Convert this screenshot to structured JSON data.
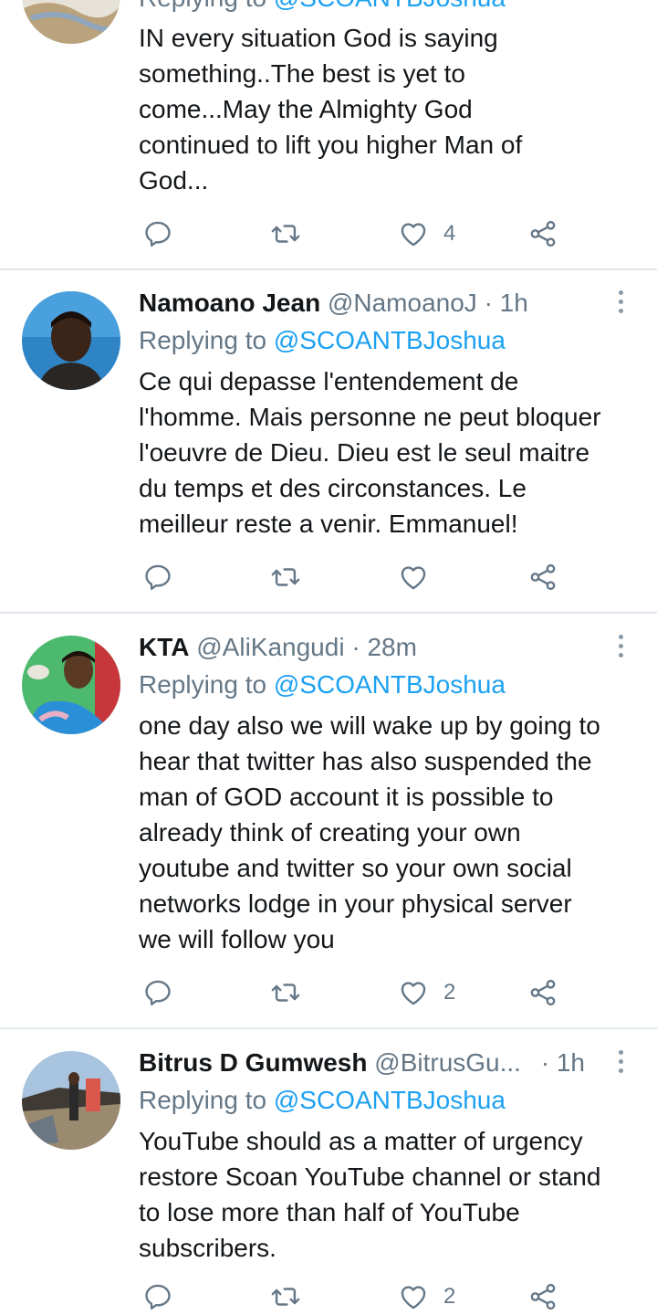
{
  "tweets": [
    {
      "reply_prefix": "Replying to",
      "reply_to": "@SCOANTBJoshua",
      "text_lines": [
        "IN every situation  God is saying",
        "something..The best is yet to",
        "come...May  the Almighty God",
        "continued  to lift you higher  Man of",
        "God..."
      ],
      "likes": "4"
    },
    {
      "name": "Namoano Jean",
      "handle": "@NamoanoJ",
      "time": "· 1h",
      "reply_prefix": "Replying to",
      "reply_to": "@SCOANTBJoshua",
      "text_lines": [
        "Ce qui depasse l'entendement de",
        "l'homme. Mais personne ne peut bloquer",
        "l'oeuvre de Dieu. Dieu est le seul maitre",
        "du temps et des circonstances. Le",
        "meilleur reste a venir. Emmanuel!"
      ],
      "likes": ""
    },
    {
      "name": "KTA",
      "handle": "@AliKangudi",
      "time": "· 28m",
      "reply_prefix": "Replying to",
      "reply_to": "@SCOANTBJoshua",
      "text_lines": [
        "one day also we will wake up by going to",
        "hear that twitter has also suspended the",
        "man of GOD account it is possible to",
        "already think of creating your own",
        "youtube and twitter so your own social",
        "networks lodge in your physical server",
        "we will follow you"
      ],
      "likes": "2"
    },
    {
      "name": "Bitrus D Gumwesh",
      "handle": "@BitrusGu...",
      "time": "· 1h",
      "reply_prefix": "Replying to",
      "reply_to": "@SCOANTBJoshua",
      "text_lines": [
        "YouTube should as a matter of urgency",
        "restore Scoan YouTube channel or stand",
        "to lose more than half of YouTube",
        "subscribers."
      ],
      "likes": "2"
    }
  ],
  "icons": {
    "reply": "reply-icon",
    "retweet": "retweet-icon",
    "like": "heart-icon",
    "share": "share-icon",
    "more": "more-vertical-icon"
  },
  "colors": {
    "link": "#1da1f2",
    "secondary_text": "#657786",
    "divider": "#e1e8ed"
  }
}
